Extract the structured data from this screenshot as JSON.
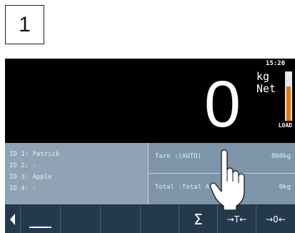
{
  "step": {
    "number": "1"
  },
  "display": {
    "time": "15:20",
    "weight": "0",
    "unit": "kg",
    "mode": "Net",
    "load_label": "LOAD",
    "load_fraction": 0.7,
    "colors": {
      "load_fill": "#e07810",
      "info_bg": "#8fa3b5",
      "softkey_bg": "#243a4c"
    }
  },
  "ids": [
    "ID 1: Patrick",
    "ID 2: -",
    "ID 3: Apple",
    "ID 4: -"
  ],
  "tare": {
    "label": "Tare  :(AUTO)",
    "value": "860kg"
  },
  "total": {
    "label": "Total :Total A",
    "value": "0kg"
  },
  "softkeys": {
    "back_icon": "triangle-left-icon",
    "underscore_icon": "underscore-icon",
    "sum_label": "Σ",
    "tare_label": "→T←",
    "zero_label": "→0←"
  }
}
